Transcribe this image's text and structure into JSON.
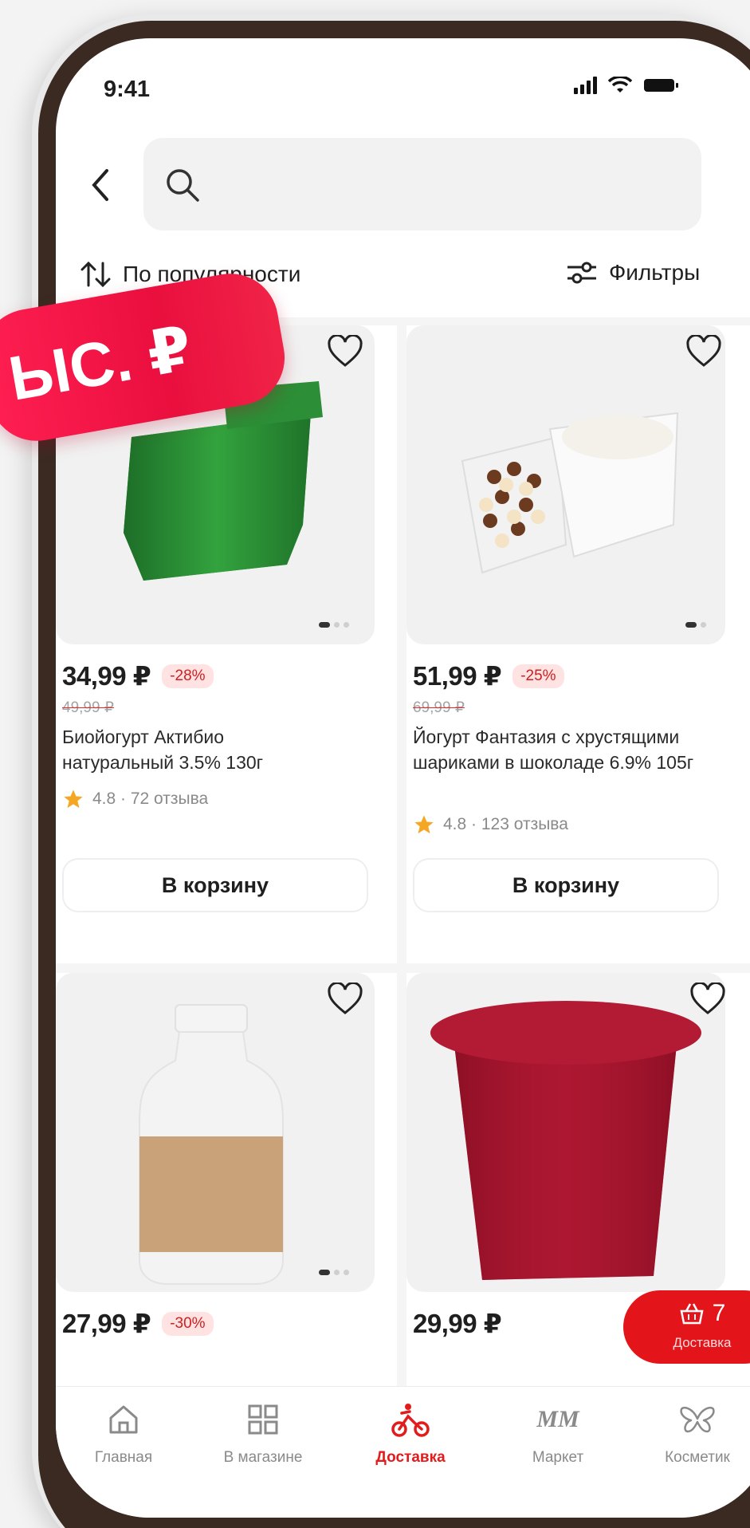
{
  "status": {
    "time": "9:41"
  },
  "search": {
    "placeholder": ""
  },
  "toolbar": {
    "sort_label": "По популярности",
    "filter_label": "Фильтры"
  },
  "promo": {
    "text": "ЫС. ₽"
  },
  "products": [
    {
      "price": "34,99 ₽",
      "discount": "-28%",
      "old_price": "49,99 ₽",
      "name": "Биойогурт Актибио натуральный 3.5% 130г",
      "rating": "4.8 · 72 отзыва",
      "cart_label": "В корзину"
    },
    {
      "price": "51,99 ₽",
      "discount": "-25%",
      "old_price": "69,99 ₽",
      "name": "Йогурт Фантазия с хрустящими шариками в шоколаде 6.9% 105г",
      "rating": "4.8 · 123 отзыва",
      "cart_label": "В корзину"
    },
    {
      "price": "27,99 ₽",
      "discount": "-30%"
    },
    {
      "price": "29,99 ₽"
    }
  ],
  "delivery_fab": {
    "count": "7",
    "label": "Доставка"
  },
  "nav": [
    {
      "label": "Главная",
      "icon": "home-icon"
    },
    {
      "label": "В магазине",
      "icon": "grid-icon"
    },
    {
      "label": "Доставка",
      "icon": "bike-icon",
      "active": true
    },
    {
      "label": "Маркет",
      "icon": "market-logo-icon"
    },
    {
      "label": "Косметик",
      "icon": "butterfly-icon"
    }
  ],
  "colors": {
    "accent": "#e31b1b",
    "promo": "#ff1f52",
    "frame": "#3a2a22"
  }
}
